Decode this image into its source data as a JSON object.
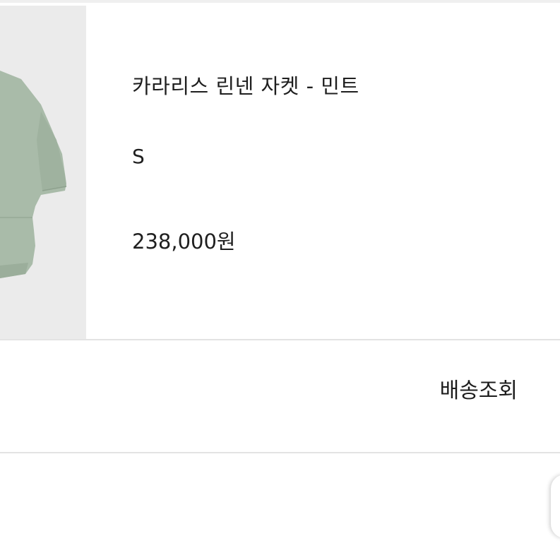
{
  "product": {
    "name": "카라리스 린넨 자켓 - 민트",
    "size": "S",
    "price": "238,000원",
    "image_color": "#a9bba9"
  },
  "actions": {
    "track_delivery_label": "배송조회"
  }
}
